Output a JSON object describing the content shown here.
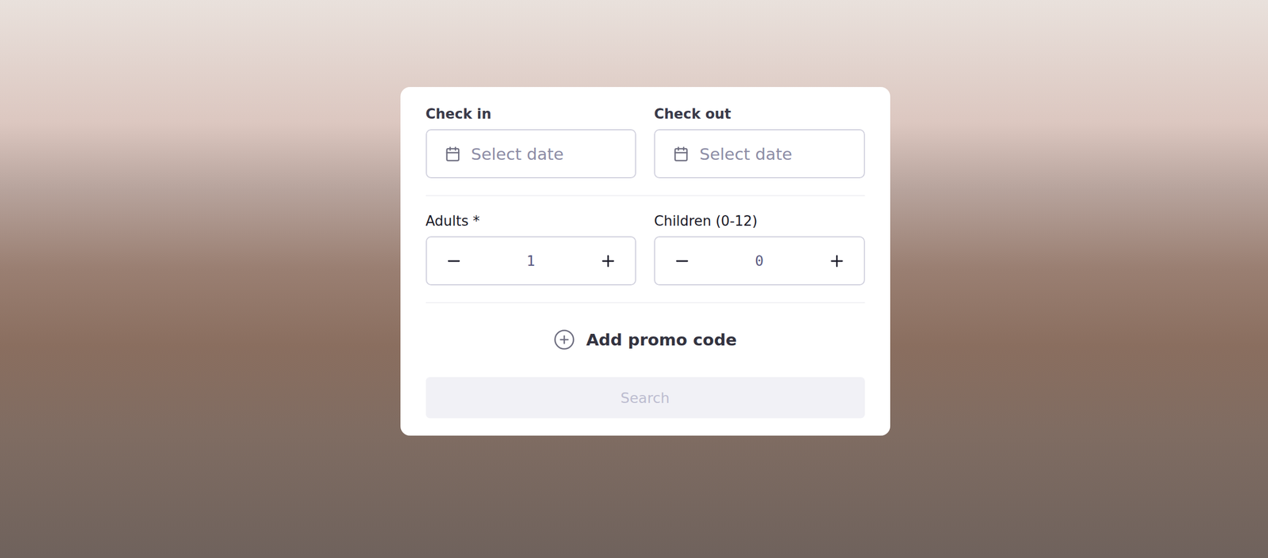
{
  "dates": [
    {
      "label": "Check in",
      "placeholder": "Select date"
    },
    {
      "label": "Check out",
      "placeholder": "Select date"
    }
  ],
  "guests": [
    {
      "label": "Adults *",
      "value": "1"
    },
    {
      "label": "Children (0-12)",
      "value": "0"
    }
  ],
  "promo": {
    "label": "Add promo code"
  },
  "search_button": {
    "label": "Search",
    "disabled": true
  }
}
